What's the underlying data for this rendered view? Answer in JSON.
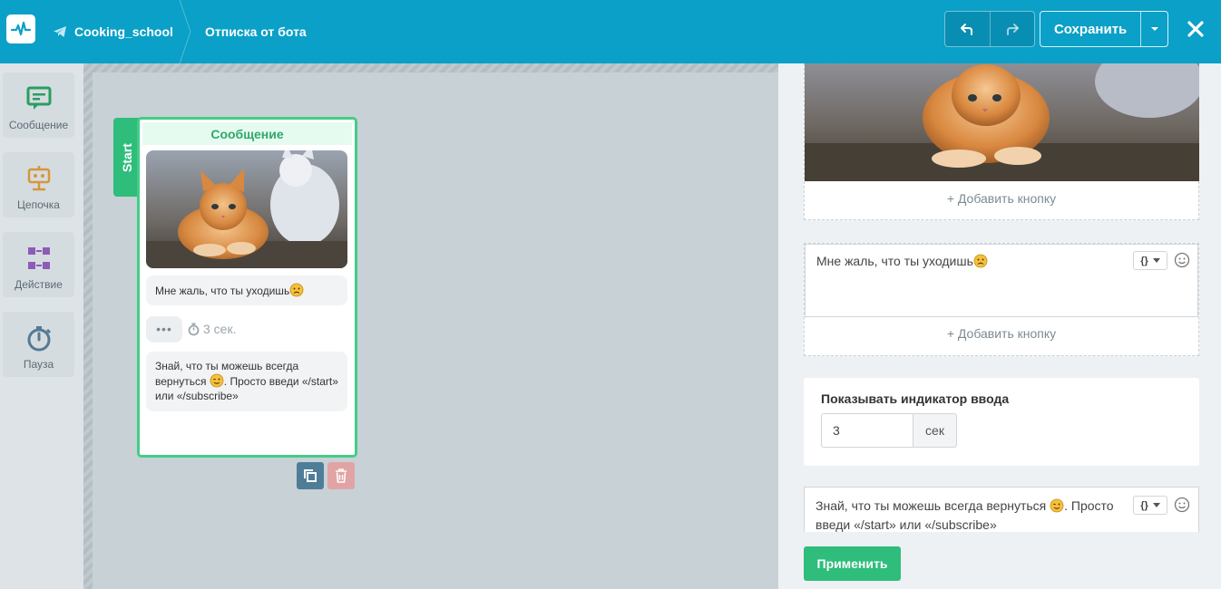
{
  "topbar": {
    "bot_name": "Cooking_school",
    "flow_name": "Отписка от бота",
    "save_label": "Сохранить"
  },
  "toolbox": {
    "items": [
      {
        "label": "Сообщение",
        "icon": "message-icon"
      },
      {
        "label": "Цепочка",
        "icon": "chain-icon"
      },
      {
        "label": "Действие",
        "icon": "action-icon"
      },
      {
        "label": "Пауза",
        "icon": "timer-icon"
      }
    ]
  },
  "canvas": {
    "start_label": "Start",
    "node": {
      "title": "Сообщение",
      "message_1": "Мне жаль, что ты уходишь",
      "typing_dots": "•••",
      "typing_delay": "3 сек.",
      "message_2_part1": "Знай, что ты можешь всегда вернуться ",
      "message_2_part2": ". Просто введи «/start» или «/subscribe»"
    }
  },
  "panel": {
    "add_button_label": "+ Добавить кнопку",
    "message_1": "Мне жаль, что ты уходишь",
    "var_label": "{}",
    "typing_title": "Показывать индикатор ввода",
    "typing_value": "3",
    "typing_unit": "сек",
    "message_2_part1": "Знай, что ты можешь всегда вернуться ",
    "message_2_part2": ". Просто введи «/start» или «/subscribe»",
    "apply_label": "Применить"
  },
  "colors": {
    "topbar": "#0aa0c7",
    "accent_green": "#2fbd7c",
    "node_border": "#44cc87",
    "chain_orange": "#e0a040",
    "action_purple": "#8e5bb5",
    "timer_blue": "#557a93"
  }
}
